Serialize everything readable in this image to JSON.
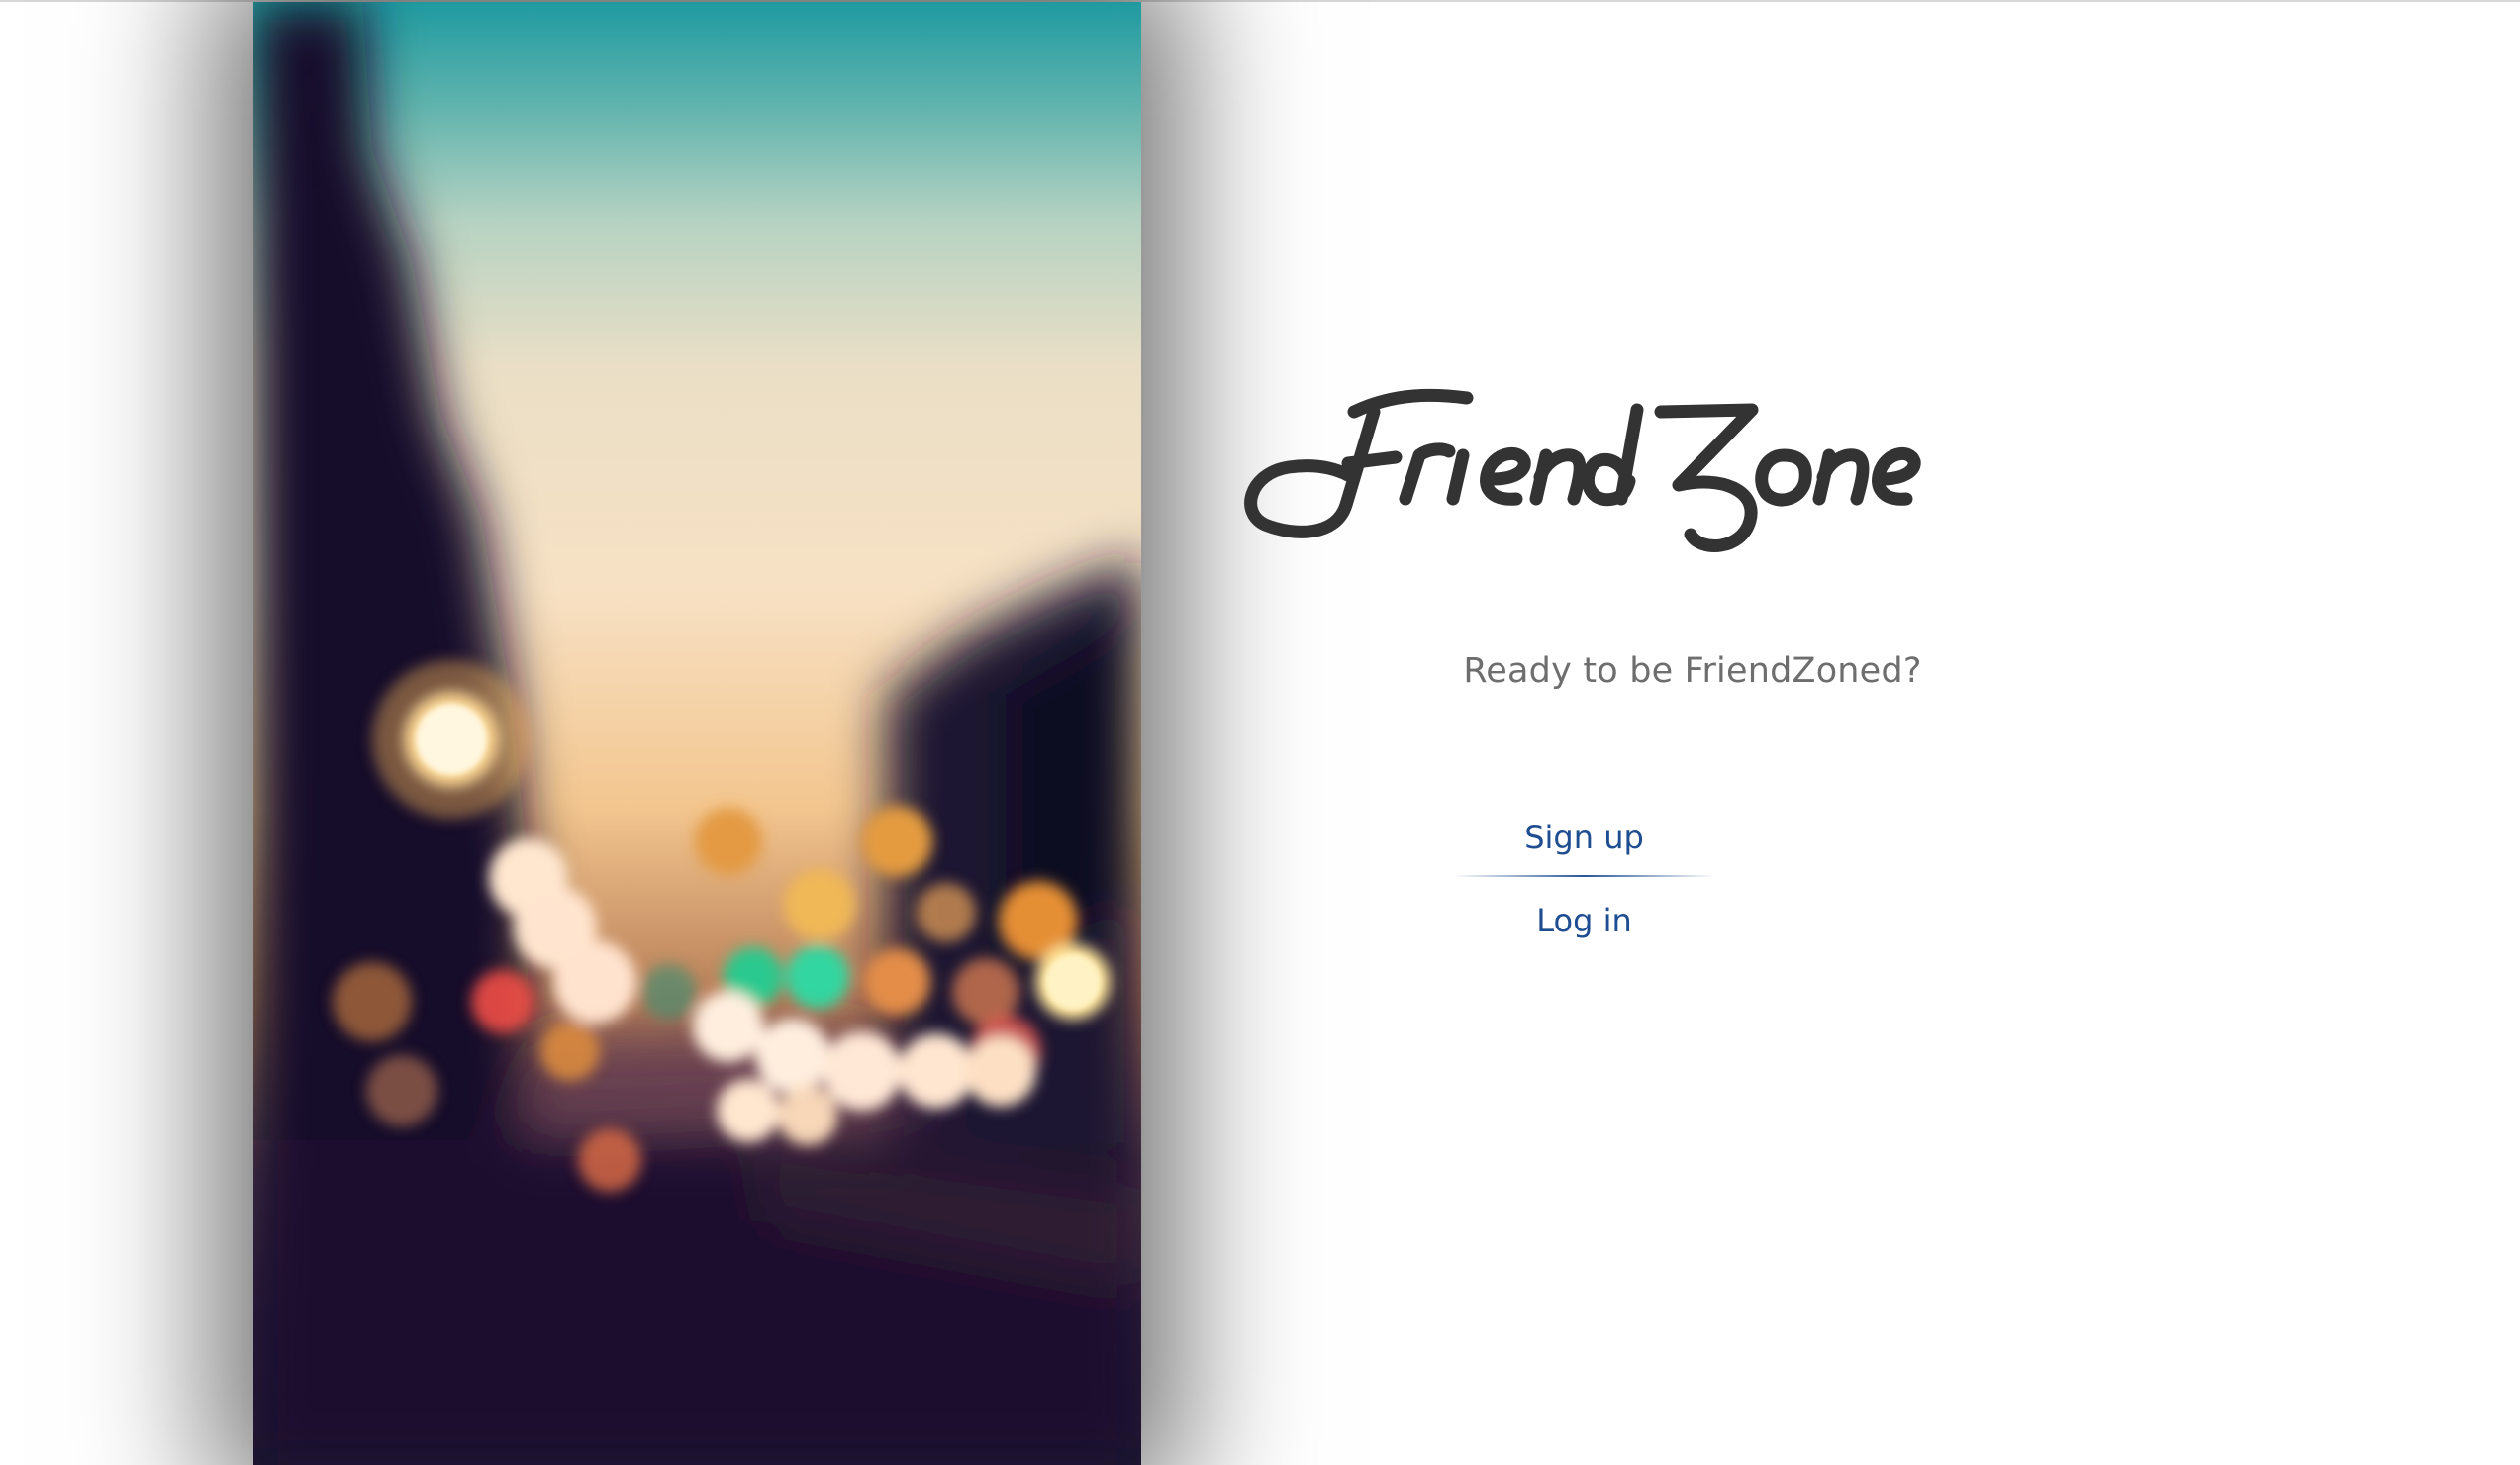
{
  "app": {
    "brand": "FriendZone",
    "tagline": "Ready to be FriendZoned?"
  },
  "auth": {
    "signup_label": "Sign up",
    "login_label": "Log in"
  },
  "colors": {
    "link": "#1f4d92",
    "tagline": "#6e6e6e",
    "logo": "#333333"
  },
  "hero": {
    "image": "blurred-city-street-bokeh-photo"
  }
}
